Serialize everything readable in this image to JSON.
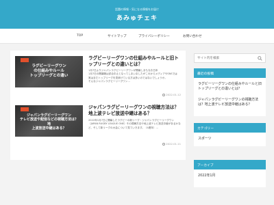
{
  "header": {
    "tagline": "話題の情報・気になる情報をお届け",
    "site_title": "あみゅチェキ"
  },
  "nav": [
    "TOP",
    "サイトマップ",
    "プライバシーポリシー",
    "お問い合わせ"
  ],
  "posts": [
    {
      "thumb_text": "ラグビーリーグワン\nの仕組みやルール\nトップリーグとの違い",
      "title": "ラグビーリーグワンの仕組みやルールと旧トップリーグとの違いとは？",
      "excerpt": "1月7日よりジャパンラグビーリーグワンが開幕しまもなお日本\n1月7日の開幕戦は試合中止となってしまいましたがこれからメディアやSNSでは\n実はまだトップリーグを見続けている方は多いのではないでしょうか。\nそんなジャパンラグビーリーグワン...",
      "date": "2022.01.12"
    },
    {
      "thumb_text": "ジャパンラグビーリーグワン\nテレビ放送や配信などの視聴方法は？地\n上波放送中継はある？",
      "title": "ジャパンラグビーリーグワンの視聴方法は？地上波テレビ放送中継はある？",
      "excerpt": "2022年1月7日に開幕したラグビーの新リーグ・ジャパンラグビーリーグワン（JAPAN RUGBY LEAGUE ONE）その視聴方法や地上波テレビ放送中継があるかなど、そして新リーグの大会について見ていきます。（4連年）...",
      "date": "2022.01.11"
    }
  ],
  "sidebar": {
    "search_placeholder": "サイト内を検索",
    "recent_heading": "最近の投稿",
    "recent_posts": [
      "ラグビーリーグワンの仕組みやルールと旧トップリーグとの違いとは？",
      "ジャパンラグビーリーグワンの視聴方法は？地上波テレビ放送中継はある？"
    ],
    "category_heading": "カテゴリー",
    "categories": [
      "スポーツ"
    ],
    "archive_heading": "アーカイブ",
    "archives": [
      "2022年1月"
    ]
  },
  "colors": {
    "accent": "#34a8c9",
    "thumb_ribbon": "#e2502c"
  }
}
